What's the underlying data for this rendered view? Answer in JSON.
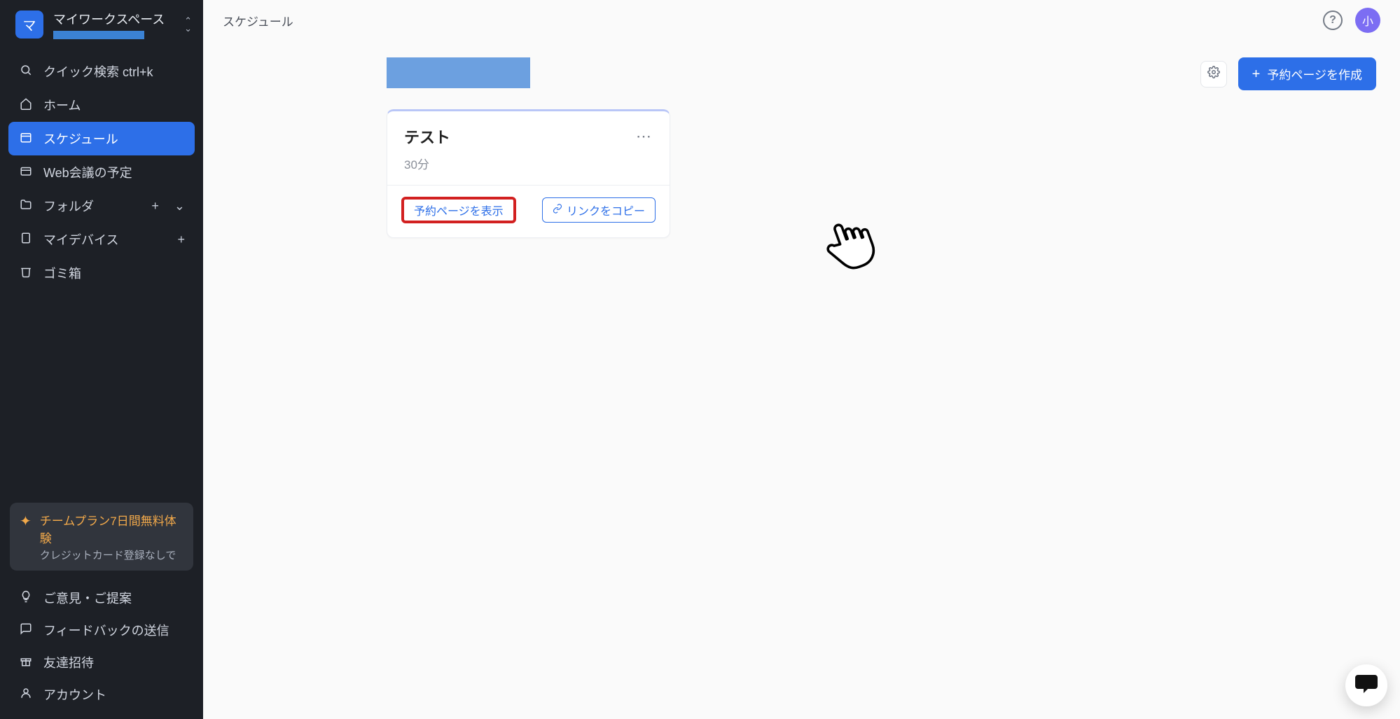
{
  "colors": {
    "accent": "#2d6fe8",
    "sidebar_bg": "#1d2026",
    "promo_accent": "#f2a94a",
    "avatar_bg": "#7c6df3",
    "highlight_red": "#d22020"
  },
  "workspace": {
    "badge_letter": "マ",
    "title": "マイワークスペース"
  },
  "sidebar": {
    "quick_search": "クイック検索 ctrl+k",
    "home": "ホーム",
    "schedule": "スケジュール",
    "web_meeting": "Web会議の予定",
    "folder": "フォルダ",
    "my_device": "マイデバイス",
    "trash": "ゴミ箱"
  },
  "promo": {
    "title": "チームプラン7日間無料体験",
    "sub": "クレジットカード登録なしで"
  },
  "footer_nav": {
    "feedback": "ご意見・ご提案",
    "send_feedback": "フィードバックの送信",
    "invite": "友達招待",
    "account": "アカウント"
  },
  "topbar": {
    "title": "スケジュール",
    "avatar_text": "小"
  },
  "actions": {
    "create_booking_page": "予約ページを作成"
  },
  "card": {
    "title": "テスト",
    "duration": "30分",
    "show_booking": "予約ページを表示",
    "copy_link": "リンクをコピー"
  }
}
